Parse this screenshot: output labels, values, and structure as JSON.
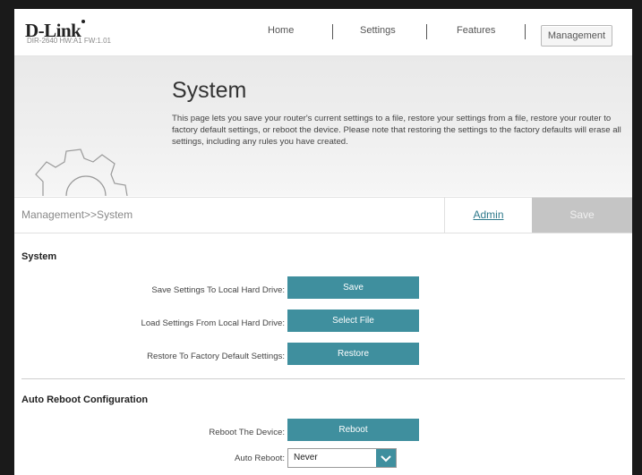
{
  "header": {
    "brand": "D-Link",
    "model": "DIR-2640 HW:A1 FW:1.01",
    "nav": [
      "Home",
      "Settings",
      "Features",
      "Management"
    ]
  },
  "banner": {
    "title": "System",
    "description": "This page lets you save your router's current settings to a file, restore your settings from a file, restore your router to factory default settings, or reboot the device. Please note that restoring the settings to the factory defaults will erase all settings, including any rules you have created."
  },
  "toolbar": {
    "breadcrumb": "Management>>System",
    "admin_label": "Admin",
    "save_label": "Save"
  },
  "system": {
    "heading": "System",
    "rows": [
      {
        "label": "Save Settings To Local Hard Drive:",
        "button": "Save"
      },
      {
        "label": "Load Settings From Local Hard Drive:",
        "button": "Select File"
      },
      {
        "label": "Restore To Factory Default Settings:",
        "button": "Restore"
      }
    ]
  },
  "auto_reboot": {
    "heading": "Auto Reboot Configuration",
    "reboot_label": "Reboot The Device:",
    "reboot_button": "Reboot",
    "auto_label": "Auto Reboot:",
    "auto_value": "Never"
  },
  "colors": {
    "accent": "#3f8f9e",
    "save_disabled": "#c5c5c5",
    "link": "#2f7a8c"
  },
  "icons": [
    "gear-icon",
    "chevron-down-icon"
  ]
}
